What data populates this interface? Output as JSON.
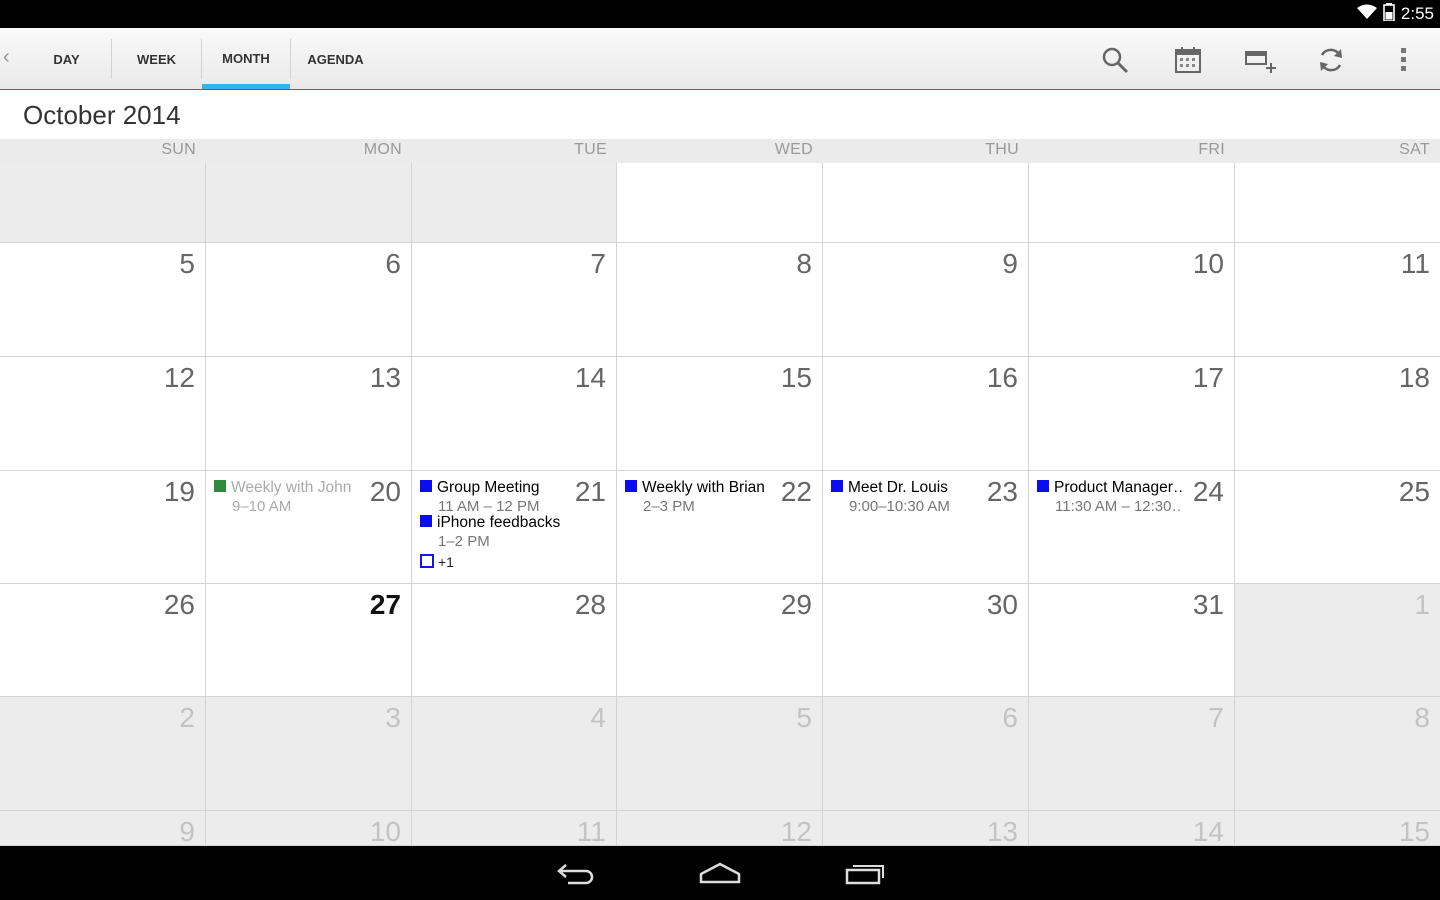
{
  "status": {
    "time": "2:55"
  },
  "toolbar": {
    "tabs": [
      {
        "label": "DAY"
      },
      {
        "label": "WEEK"
      },
      {
        "label": "MONTH",
        "active": true
      },
      {
        "label": "AGENDA"
      }
    ],
    "icons": [
      "search-icon",
      "calendar-today-icon",
      "new-event-icon",
      "refresh-icon",
      "overflow-menu-icon"
    ]
  },
  "month_title": "October 2014",
  "weekdays": [
    "SUN",
    "MON",
    "TUE",
    "WED",
    "THU",
    "FRI",
    "SAT"
  ],
  "weeks": [
    [
      {
        "day": "",
        "grey": true
      },
      {
        "day": "",
        "grey": true
      },
      {
        "day": "",
        "grey": true
      },
      {
        "day": "",
        "grey": false
      },
      {
        "day": "",
        "grey": false
      },
      {
        "day": "",
        "grey": false
      },
      {
        "day": "",
        "grey": false
      }
    ],
    [
      {
        "day": "5"
      },
      {
        "day": "6"
      },
      {
        "day": "7"
      },
      {
        "day": "8"
      },
      {
        "day": "9"
      },
      {
        "day": "10"
      },
      {
        "day": "11"
      }
    ],
    [
      {
        "day": "12"
      },
      {
        "day": "13"
      },
      {
        "day": "14"
      },
      {
        "day": "15"
      },
      {
        "day": "16"
      },
      {
        "day": "17"
      },
      {
        "day": "18"
      }
    ],
    [
      {
        "day": "19"
      },
      {
        "day": "20",
        "events": [
          {
            "title": "Weekly with John",
            "time": "9–10 AM",
            "color": "#2e8b3c",
            "faded": true
          }
        ]
      },
      {
        "day": "21",
        "events": [
          {
            "title": "Group Meeting",
            "time": "11 AM – 12 PM",
            "color": "#0c0cf0"
          },
          {
            "title": "iPhone feedbacks",
            "time": "1–2 PM",
            "color": "#0c0cf0"
          }
        ],
        "more": "+1"
      },
      {
        "day": "22",
        "events": [
          {
            "title": "Weekly with Brian",
            "time": "2–3 PM",
            "color": "#0c0cf0"
          }
        ]
      },
      {
        "day": "23",
        "events": [
          {
            "title": "Meet Dr. Louis",
            "time": "9:00–10:30 AM",
            "color": "#0c0cf0"
          }
        ]
      },
      {
        "day": "24",
        "events": [
          {
            "title": "Product Manager…",
            "time": "11:30 AM – 12:30…",
            "color": "#0c0cf0"
          }
        ]
      },
      {
        "day": "25"
      }
    ],
    [
      {
        "day": "26"
      },
      {
        "day": "27",
        "today": true
      },
      {
        "day": "28"
      },
      {
        "day": "29"
      },
      {
        "day": "30"
      },
      {
        "day": "31"
      },
      {
        "day": "1",
        "grey": true,
        "dim": true
      }
    ],
    [
      {
        "day": "2",
        "grey": true,
        "dim": true
      },
      {
        "day": "3",
        "grey": true,
        "dim": true
      },
      {
        "day": "4",
        "grey": true,
        "dim": true
      },
      {
        "day": "5",
        "grey": true,
        "dim": true
      },
      {
        "day": "6",
        "grey": true,
        "dim": true
      },
      {
        "day": "7",
        "grey": true,
        "dim": true
      },
      {
        "day": "8",
        "grey": true,
        "dim": true
      }
    ],
    [
      {
        "day": "9",
        "grey": true,
        "dim": true
      },
      {
        "day": "10",
        "grey": true,
        "dim": true
      },
      {
        "day": "11",
        "grey": true,
        "dim": true
      },
      {
        "day": "12",
        "grey": true,
        "dim": true
      },
      {
        "day": "13",
        "grey": true,
        "dim": true
      },
      {
        "day": "14",
        "grey": true,
        "dim": true
      },
      {
        "day": "15",
        "grey": true,
        "dim": true
      }
    ]
  ],
  "colors": {
    "accent": "#33b5e5",
    "divider": "#cc2b5e",
    "event_blue": "#0c0cf0",
    "event_green": "#2e8b3c"
  }
}
